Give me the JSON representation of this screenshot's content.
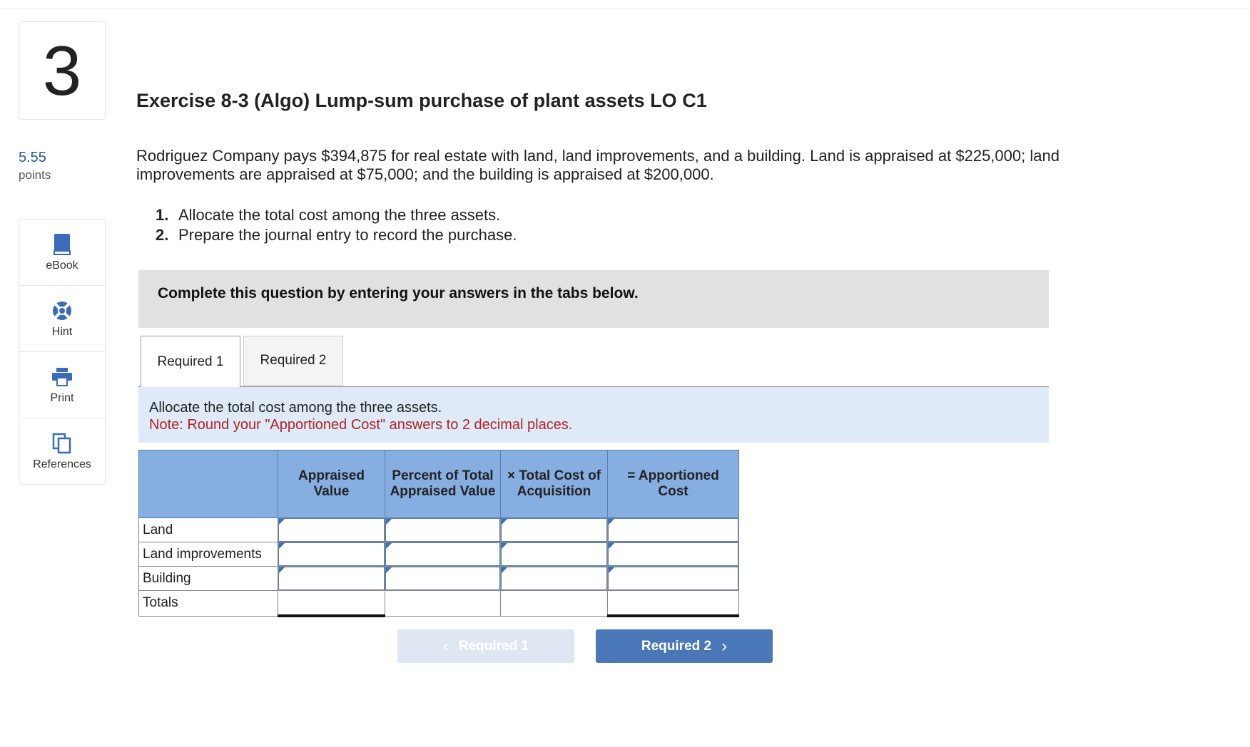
{
  "question": {
    "number": "3",
    "points_value": "5.55",
    "points_label": "points",
    "title": "Exercise 8-3 (Algo) Lump-sum purchase of plant assets LO C1",
    "problem_text": "Rodriguez Company pays $394,875 for real estate with land, land improvements, and a building. Land is appraised at $225,000; land improvements are appraised at $75,000; and the building is appraised at $200,000.",
    "steps": [
      {
        "num": "1.",
        "text": "Allocate the total cost among the three assets."
      },
      {
        "num": "2.",
        "text": "Prepare the journal entry to record the purchase."
      }
    ]
  },
  "tools": [
    {
      "label": "eBook",
      "icon": "book-icon"
    },
    {
      "label": "Hint",
      "icon": "lifebuoy-icon"
    },
    {
      "label": "Print",
      "icon": "printer-icon"
    },
    {
      "label": "References",
      "icon": "copy-icon"
    }
  ],
  "instructions": "Complete this question by entering your answers in the tabs below.",
  "tabs": [
    {
      "label": "Required 1",
      "active": true
    },
    {
      "label": "Required 2",
      "active": false
    }
  ],
  "panel": {
    "text": "Allocate the total cost among the three assets.",
    "note": "Note: Round your \"Apportioned Cost\" answers to 2 decimal places."
  },
  "table": {
    "headers": [
      "",
      "Appraised Value",
      "Percent of Total Appraised Value",
      "× Total Cost of Acquisition",
      "= Apportioned Cost"
    ],
    "rows": [
      "Land",
      "Land improvements",
      "Building",
      "Totals"
    ]
  },
  "navigation": {
    "prev_label": "Required 1",
    "next_label": "Required 2"
  },
  "colors": {
    "header_blue": "#87aee0",
    "button_blue": "#4a77b7",
    "note_red": "#b22222"
  }
}
